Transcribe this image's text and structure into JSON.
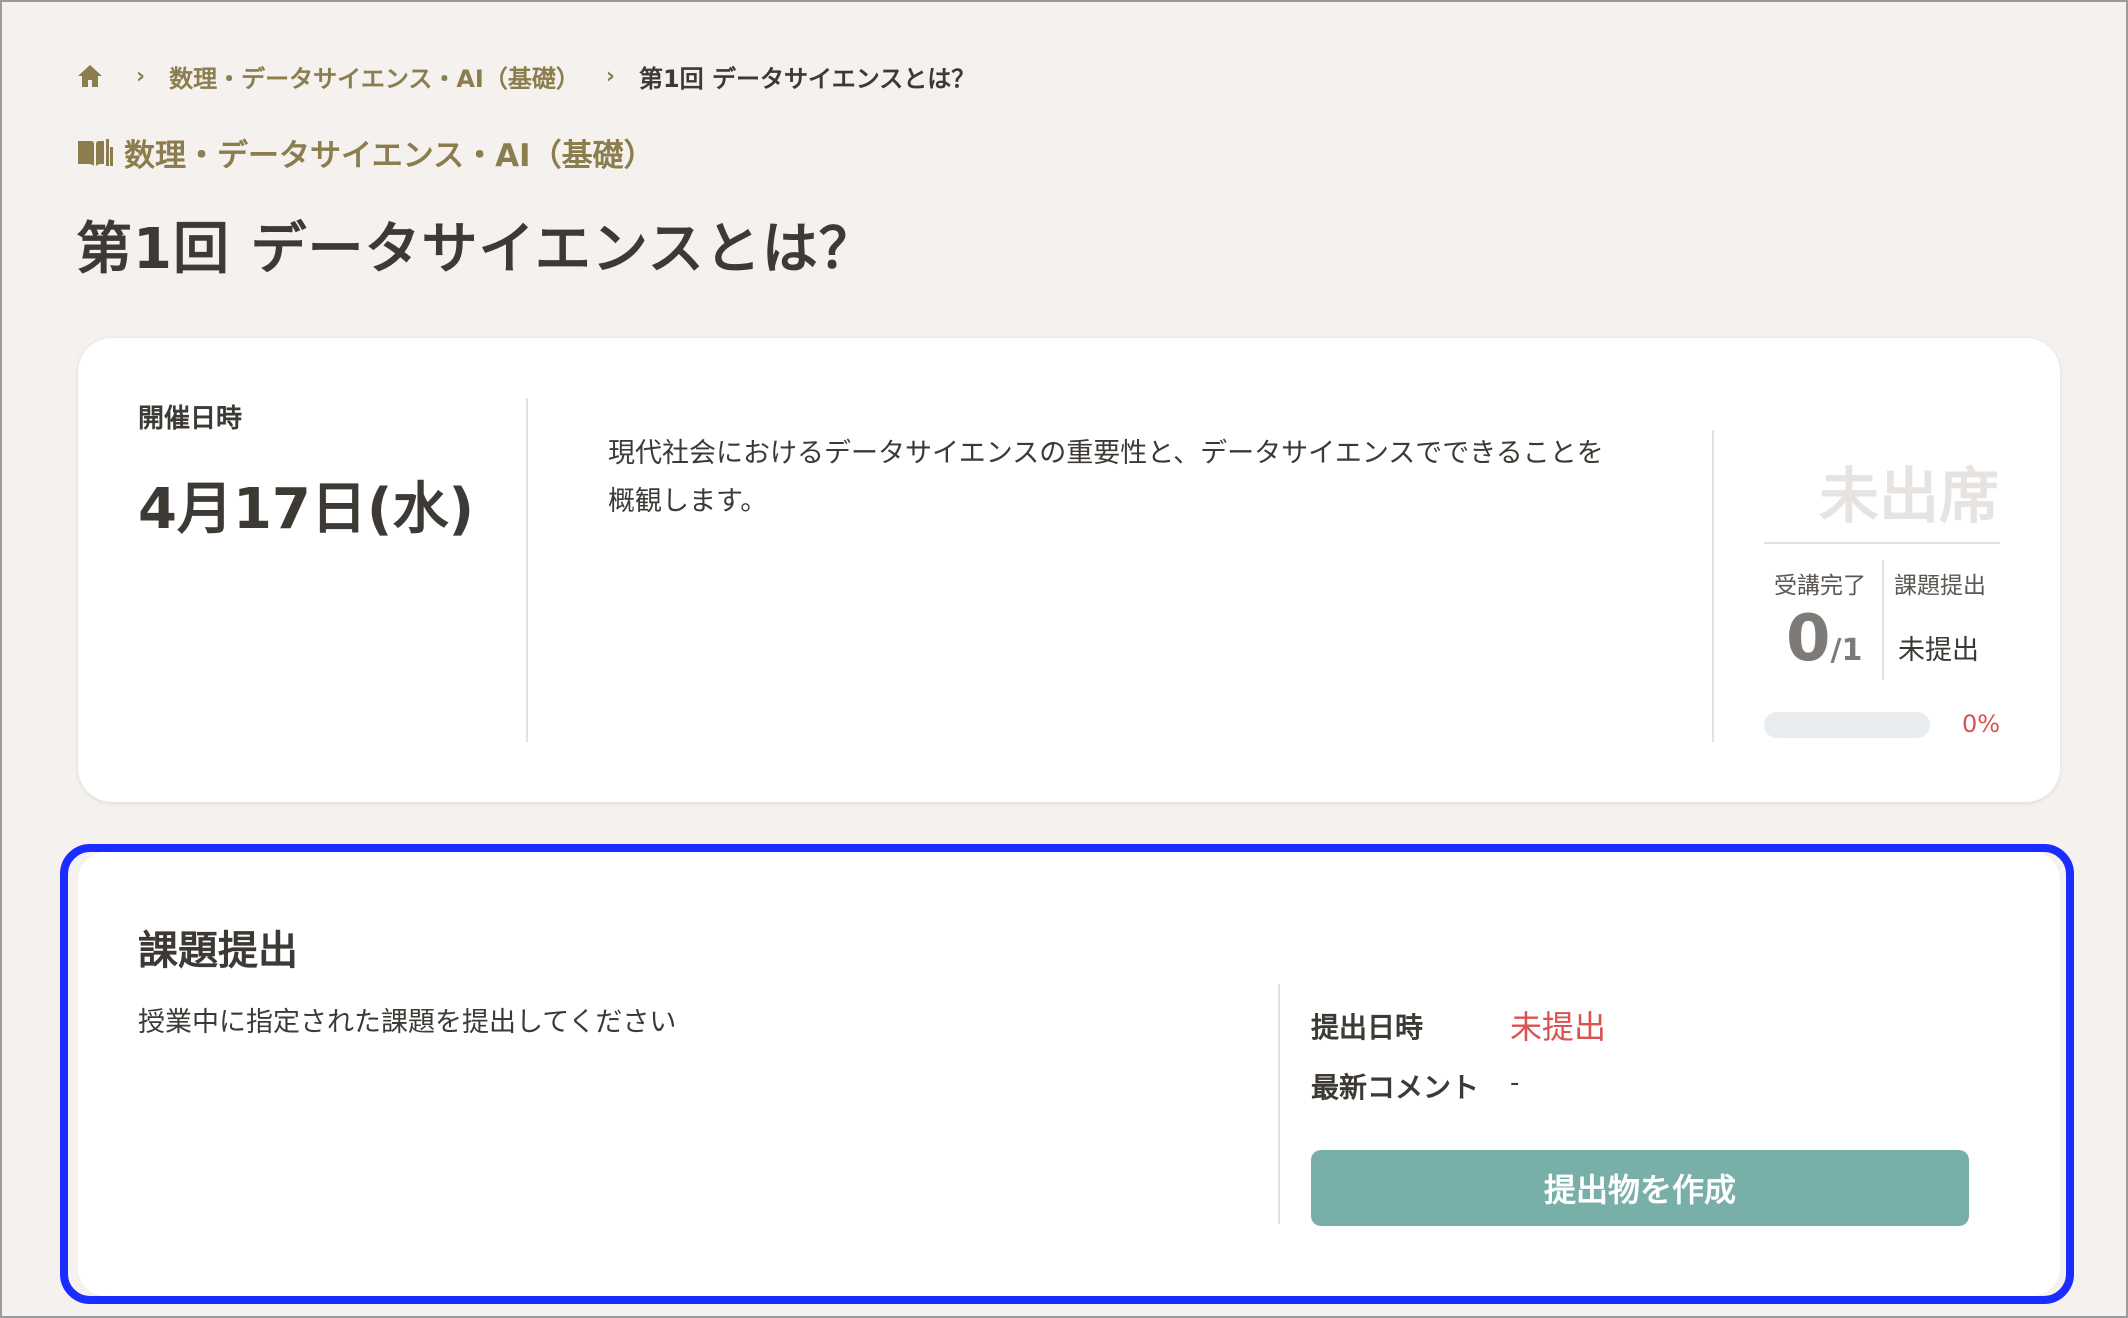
{
  "breadcrumb": {
    "home_icon": "home-icon",
    "separator_icon": "chevron-right-icon",
    "course": "数理・データサイエンス・AI（基礎）",
    "current": "第1回 データサイエンスとは？"
  },
  "course": {
    "icon": "book-icon",
    "name": "数理・データサイエンス・AI（基礎）"
  },
  "page_title": "第1回 データサイエンスとは？",
  "session": {
    "date_label": "開催日時",
    "date_value": "4月17日(水)",
    "description": "現代社会におけるデータサイエンスの重要性と、データサイエンスでできることを概観します。",
    "attendance_status": "未出席",
    "completion_label": "受講完了",
    "completion_count": "0",
    "completion_total": "/1",
    "assignment_label": "課題提出",
    "assignment_status": "未提出",
    "progress_percent": 0,
    "progress_text": "0%"
  },
  "assignment": {
    "title": "課題提出",
    "description": "授業中に指定された課題を提出してください",
    "submitted_label": "提出日時",
    "submitted_status": "未提出",
    "comment_label": "最新コメント",
    "comment_value": "-",
    "create_button": "提出物を作成"
  },
  "colors": {
    "background": "#f4f1ee",
    "accent_olive": "#8b7d4e",
    "alert_red": "#d9534f",
    "button_teal": "#78b0a9",
    "highlight_blue": "#1a2cff"
  }
}
